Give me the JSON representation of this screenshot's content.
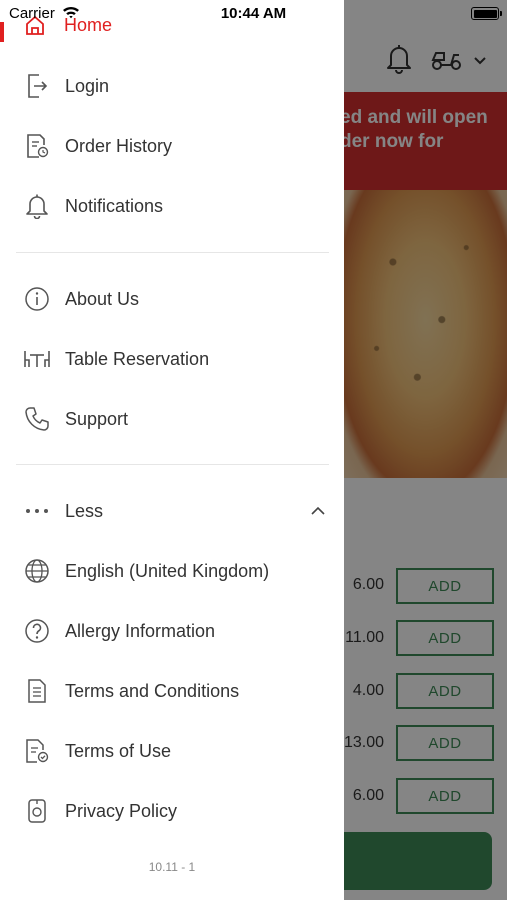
{
  "status_bar": {
    "carrier": "Carrier",
    "time": "10:44 AM"
  },
  "background_app": {
    "banner_line1": "ed and will open",
    "banner_line2": "der now for",
    "prices": [
      "6.00",
      "11.00",
      "4.00",
      "13.00",
      "6.00"
    ],
    "add_label": "ADD"
  },
  "drawer": {
    "home_label": "Home",
    "section1": [
      {
        "label": "Login",
        "icon": "login-icon"
      },
      {
        "label": "Order History",
        "icon": "order-history-icon"
      },
      {
        "label": "Notifications",
        "icon": "bell-icon"
      }
    ],
    "section2": [
      {
        "label": "About Us",
        "icon": "info-icon"
      },
      {
        "label": "Table Reservation",
        "icon": "table-icon"
      },
      {
        "label": "Support",
        "icon": "phone-icon"
      }
    ],
    "less_label": "Less",
    "section3": [
      {
        "label": "English (United Kingdom)",
        "icon": "globe-icon"
      },
      {
        "label": "Allergy Information",
        "icon": "question-icon"
      },
      {
        "label": "Terms and Conditions",
        "icon": "document-icon"
      },
      {
        "label": "Terms of Use",
        "icon": "document-check-icon"
      },
      {
        "label": "Privacy Policy",
        "icon": "privacy-icon"
      }
    ],
    "version": "10.11 - 1"
  },
  "colors": {
    "accent": "#e02020",
    "add_green": "#3f8a57",
    "banner_red": "#d32f2f"
  }
}
